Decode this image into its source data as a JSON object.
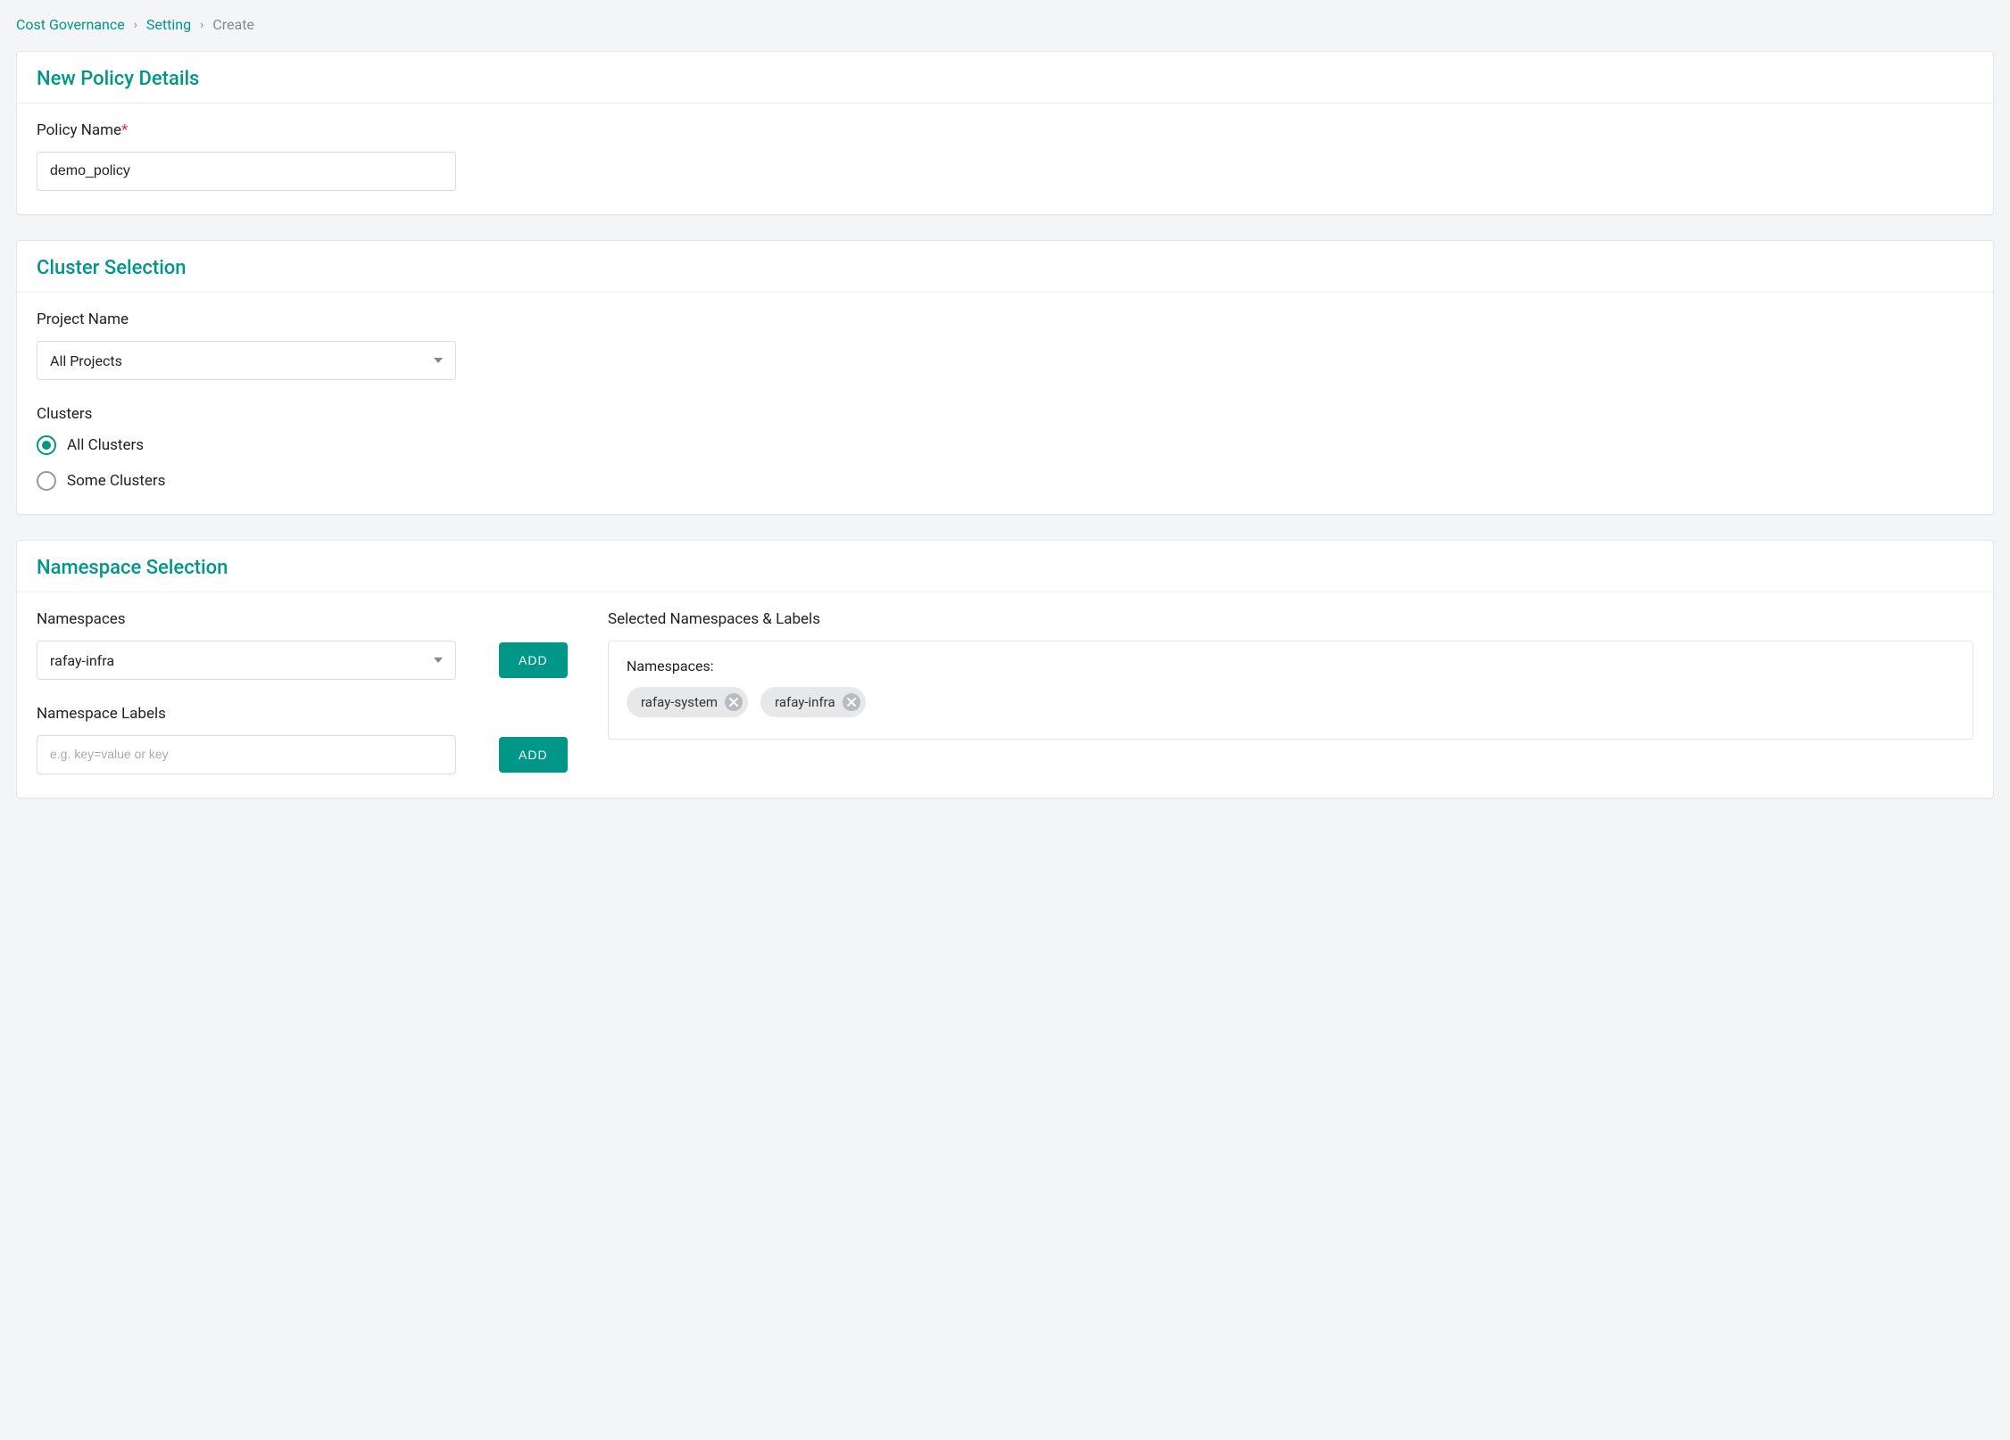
{
  "breadcrumb": {
    "root": "Cost Governance",
    "mid": "Setting",
    "current": "Create"
  },
  "policy_details": {
    "header": "New Policy Details",
    "name_label": "Policy Name",
    "name_value": "demo_policy"
  },
  "cluster_selection": {
    "header": "Cluster Selection",
    "project_label": "Project Name",
    "project_value": "All Projects",
    "clusters_label": "Clusters",
    "radio_all": "All Clusters",
    "radio_some": "Some Clusters",
    "selected": "all"
  },
  "namespace_selection": {
    "header": "Namespace Selection",
    "namespaces_label": "Namespaces",
    "namespace_value": "rafay-infra",
    "add_ns_label": "ADD",
    "labels_label": "Namespace Labels",
    "labels_placeholder": "e.g. key=value or key",
    "add_label_label": "ADD",
    "selected_header": "Selected Namespaces & Labels",
    "selected_sub": "Namespaces:",
    "chips": [
      "rafay-system",
      "rafay-infra"
    ]
  }
}
